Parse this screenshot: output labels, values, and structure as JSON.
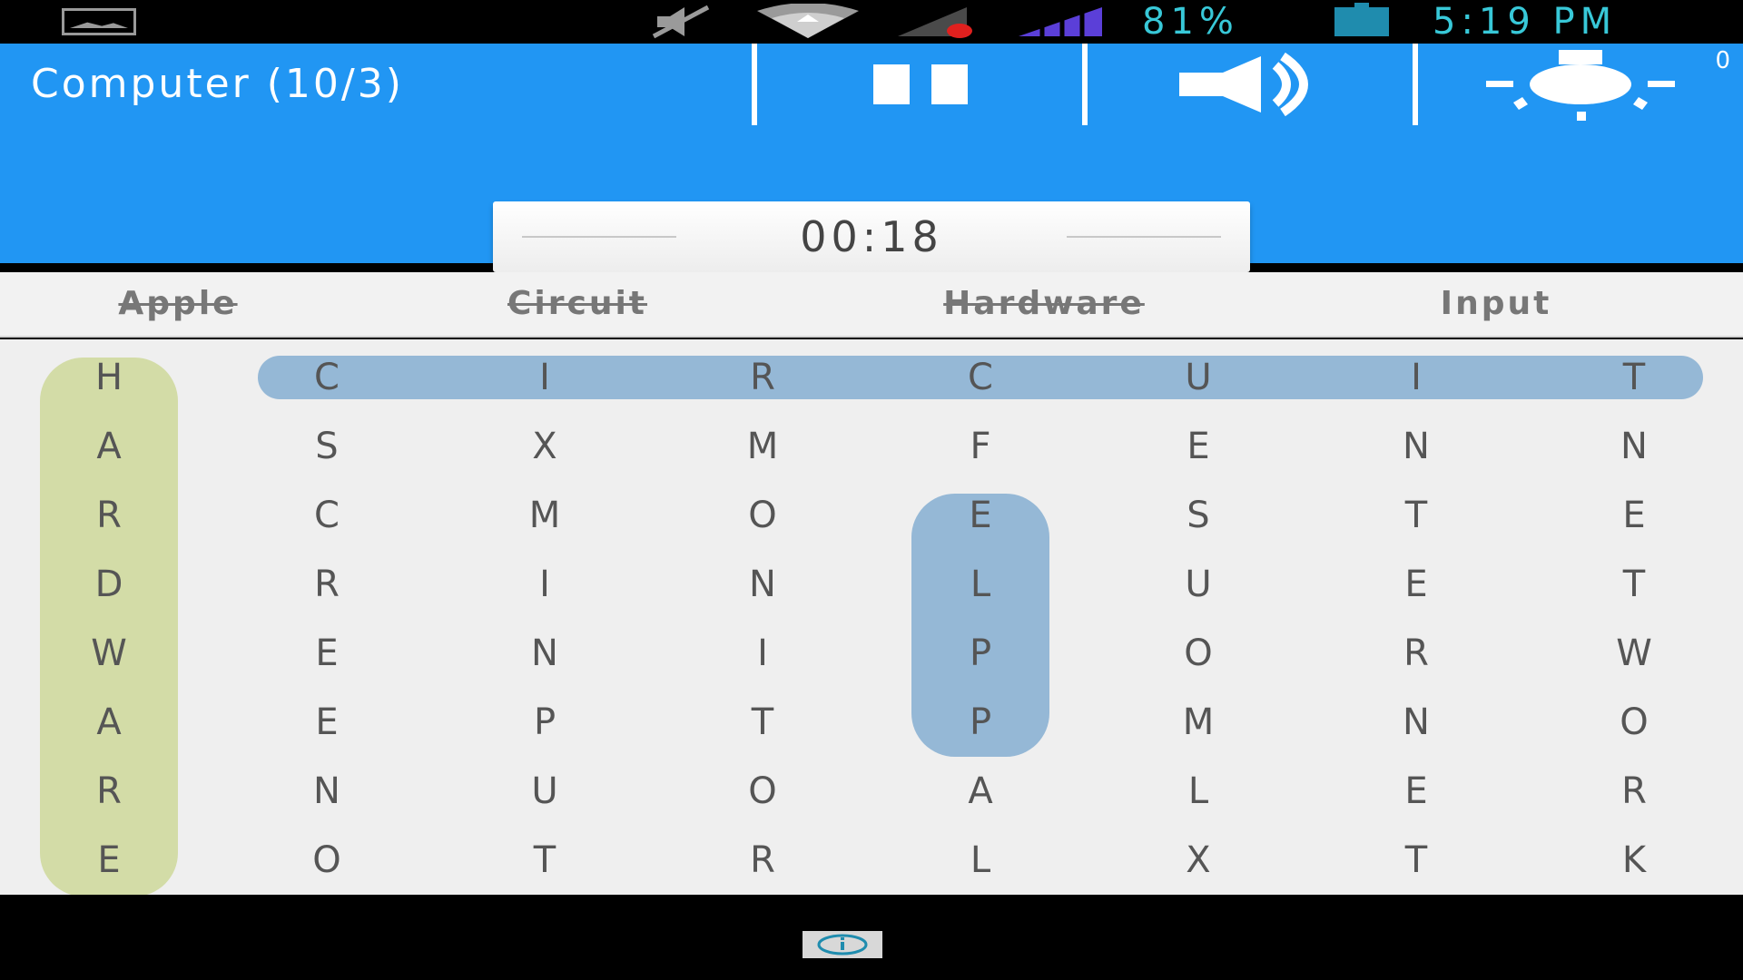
{
  "status_bar": {
    "battery_text": "81%",
    "time_text": "5:19 PM",
    "icons": [
      "gallery-icon",
      "mute-icon",
      "wifi-icon",
      "signal-roaming-icon",
      "signal-icon",
      "battery-icon"
    ]
  },
  "header": {
    "title": "Computer (10/3)",
    "hint_count": "0",
    "buttons": [
      "pause-icon",
      "sound-icon",
      "hint-bulb-icon"
    ],
    "background_color": "#2196f3"
  },
  "timer": {
    "value": "00:18"
  },
  "words": [
    {
      "label": "Apple",
      "found": true
    },
    {
      "label": "Circuit",
      "found": true
    },
    {
      "label": "Hardware",
      "found": true
    },
    {
      "label": "Input",
      "found": false
    }
  ],
  "grid": {
    "rows": [
      [
        "H",
        "C",
        "I",
        "R",
        "C",
        "U",
        "I",
        "T"
      ],
      [
        "A",
        "S",
        "X",
        "M",
        "F",
        "E",
        "N",
        "N"
      ],
      [
        "R",
        "C",
        "M",
        "O",
        "E",
        "S",
        "T",
        "E"
      ],
      [
        "D",
        "R",
        "I",
        "N",
        "L",
        "U",
        "E",
        "T"
      ],
      [
        "W",
        "E",
        "N",
        "I",
        "P",
        "O",
        "R",
        "W"
      ],
      [
        "A",
        "E",
        "P",
        "T",
        "P",
        "M",
        "N",
        "O"
      ],
      [
        "R",
        "N",
        "U",
        "O",
        "A",
        "L",
        "E",
        "R"
      ],
      [
        "E",
        "O",
        "T",
        "R",
        "L",
        "X",
        "T",
        "K"
      ]
    ],
    "highlights": [
      {
        "word": "Hardware",
        "color": "#d3dca7"
      },
      {
        "word": "Circuit",
        "color": "#95b8d6"
      },
      {
        "word": "Apple",
        "color": "#95b8d6"
      }
    ]
  }
}
